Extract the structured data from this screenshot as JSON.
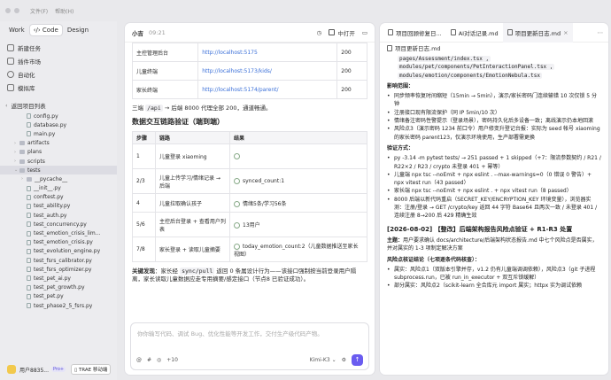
{
  "menu": {
    "file": "文件(F)",
    "help": "帮助(H)"
  },
  "mode_tabs": [
    "Work",
    "Code",
    "Design"
  ],
  "sidebar": {
    "items": [
      {
        "label": "新建任务",
        "icon": "plus-icon"
      },
      {
        "label": "插件市场",
        "icon": "grid-icon"
      },
      {
        "label": "自动化",
        "icon": "clock-icon"
      },
      {
        "label": "模拟库",
        "icon": "box-icon"
      }
    ],
    "project_section": "返回项目列表",
    "tree": [
      {
        "name": "config.py",
        "indent": 3,
        "kind": "file"
      },
      {
        "name": "database.py",
        "indent": 3,
        "kind": "file"
      },
      {
        "name": "main.py",
        "indent": 3,
        "kind": "file"
      },
      {
        "name": "artifacts",
        "indent": 2,
        "kind": "folder"
      },
      {
        "name": "plans",
        "indent": 2,
        "kind": "folder"
      },
      {
        "name": "scripts",
        "indent": 2,
        "kind": "folder"
      },
      {
        "name": "tests",
        "indent": 2,
        "kind": "folder-open",
        "selected": true
      },
      {
        "name": "__pycache__",
        "indent": 3,
        "kind": "folder"
      },
      {
        "name": "__init__.py",
        "indent": 3,
        "kind": "file"
      },
      {
        "name": "conftest.py",
        "indent": 3,
        "kind": "file"
      },
      {
        "name": "test_ability.py",
        "indent": 3,
        "kind": "file"
      },
      {
        "name": "test_auth.py",
        "indent": 3,
        "kind": "file"
      },
      {
        "name": "test_concurrency.py",
        "indent": 3,
        "kind": "file"
      },
      {
        "name": "test_emotion_crisis_lim...",
        "indent": 3,
        "kind": "file"
      },
      {
        "name": "test_emotion_crisis.py",
        "indent": 3,
        "kind": "file"
      },
      {
        "name": "test_evolution_engine.py",
        "indent": 3,
        "kind": "file"
      },
      {
        "name": "test_fsrs_calibrator.py",
        "indent": 3,
        "kind": "file"
      },
      {
        "name": "test_fsrs_optimizer.py",
        "indent": 3,
        "kind": "file"
      },
      {
        "name": "test_pet_ai.py",
        "indent": 3,
        "kind": "file"
      },
      {
        "name": "test_pet_growth.py",
        "indent": 3,
        "kind": "file"
      },
      {
        "name": "test_pet.py",
        "indent": 3,
        "kind": "file"
      },
      {
        "name": "test_phase2_5_fsrs.py",
        "indent": 3,
        "kind": "file"
      }
    ],
    "user_name": "用户8835...",
    "badge": "Pro+",
    "trae": "TRAE 移动端"
  },
  "chat": {
    "title": "小吉",
    "time": "09:21",
    "open_in": "中打开",
    "table1": [
      [
        "主控管理后台",
        "http://localhost:5175",
        "200"
      ],
      [
        "儿童终端",
        "http://localhost:5173/kids/",
        "200"
      ],
      [
        "家长终端",
        "http://localhost:5174/parent/",
        "200"
      ]
    ],
    "para1_a": "三端 ",
    "para1_code": "/api",
    "para1_b": " → 后端 8000 代理全部 200，通道畅通。",
    "heading": "数据交互链路验证（端到端）",
    "table2_headers": [
      "步骤",
      "链路",
      "结果"
    ],
    "table2": [
      {
        "step": "1",
        "link": "儿童登录 xiaoming",
        "result": "",
        "check": true
      },
      {
        "step": "2/3",
        "link": "儿童上传学习/情绪记录 → 后端",
        "result": "synced_count:1",
        "check": true
      },
      {
        "step": "4",
        "link": "儿童拉取确认孩子",
        "result": "情绪5条/学习56条",
        "check": true
      },
      {
        "step": "5/6",
        "link": "主控后台登录 + 查看用户列表",
        "result": "13用户",
        "check": true
      },
      {
        "step": "7/8",
        "link": "家长登录 + 读取儿童摘要",
        "result": "today_emotion_count:2（儿童数据推送至家长视图）",
        "check": true
      }
    ],
    "para2_bold": "关键发现",
    "para2_a": "：家长经 ",
    "para2_code": "sync/pull",
    "para2_b": " 返回 0 条属设计行为——该接口强制按当前登录用户隔离，家长读取儿童数据应走专用摘要/感定接口（节点8 已验证成功）。",
    "placeholder": "你你输写代码、调试 Bug、优化性能等开发工作，交付生产级代码产物。",
    "toolbar": [
      "@",
      "#",
      "◎",
      "+10"
    ],
    "model": "Kimi-K3"
  },
  "doc": {
    "tabs": [
      "项目回顾修复日...",
      "AI对话记录.md",
      "项目更新日志.md"
    ],
    "sub": "项目更新日志.md",
    "lines_top": [
      "pages/Assessment/index.tsx ,",
      "modules/pet/components/PetInteractionPanel.tsx ,",
      "modules/emotion/components/EmotionNebula.tsx"
    ],
    "impact_label": "影响范围：",
    "impact": [
      "同步频率恢复时间缩短（15min → 5min），演示/家长密码门连续输错 10 次仅锁 5 分钟",
      "注册接口现有限流保护（同 IP 5min/10 次）",
      "情绪备注密码性警提示（登录场景），密码持久化后多设备一致；离线演示仍本地回滚",
      "风险点3（演示密码 1234 前口令）用户修变升登记台报：实际为 seed 帐号 xiaoming 的家长密码 parent123，仅演示环境使用，生产部署需更换"
    ],
    "verify_label": "验证方式：",
    "verify": [
      "py -3.14 -m pytest tests/ → 251 passed + 1 skipped（+7：限流参数契约 / R21 / R22×2 / R23 / crypto 未登录 401 + 幂等）",
      "儿童端 npx tsc --noEmit + npx eslint . --max-warnings=0（0 错误 0 警告）+ npx vitest run（43 passed）",
      "家长端 npx tsc --noEmit + npx eslint . + npx vitest run（8 passed）",
      "8000 后端以新代码重启（SECRET_KEY/ENCRYPTION_KEY 环境变量），浏览器实测：注册/登录 → GET /crypto/key 返回 44 字符 Base64 且两次一致 / 未登录 401 / 连续注册 8→200 后 429 精确生效"
    ],
    "section_title": "[2026-08-02] 【整改】后端架构报告风险点验证 + R1-R3 处置",
    "theme_label": "主题：",
    "theme": "用户要求确认 docs/architecture/后端架构状态报告.md 中七个风险点是否属实，并对属实的 1-3 项制定解决方案",
    "risk_label": "风险点核证结论（七项逐条代码核查）：",
    "risks": [
      "属实：风险点1（双版本引擎并存，v1.2 仍有儿童端调调依赖），风险点3（git 子进程 subprocess.run，已被 run_in_executor + 双互斥锁缓解）",
      "部分属实：风险点2（scikit-learn 全合库元 import 属实；httpx 实为调试依赖"
    ]
  }
}
